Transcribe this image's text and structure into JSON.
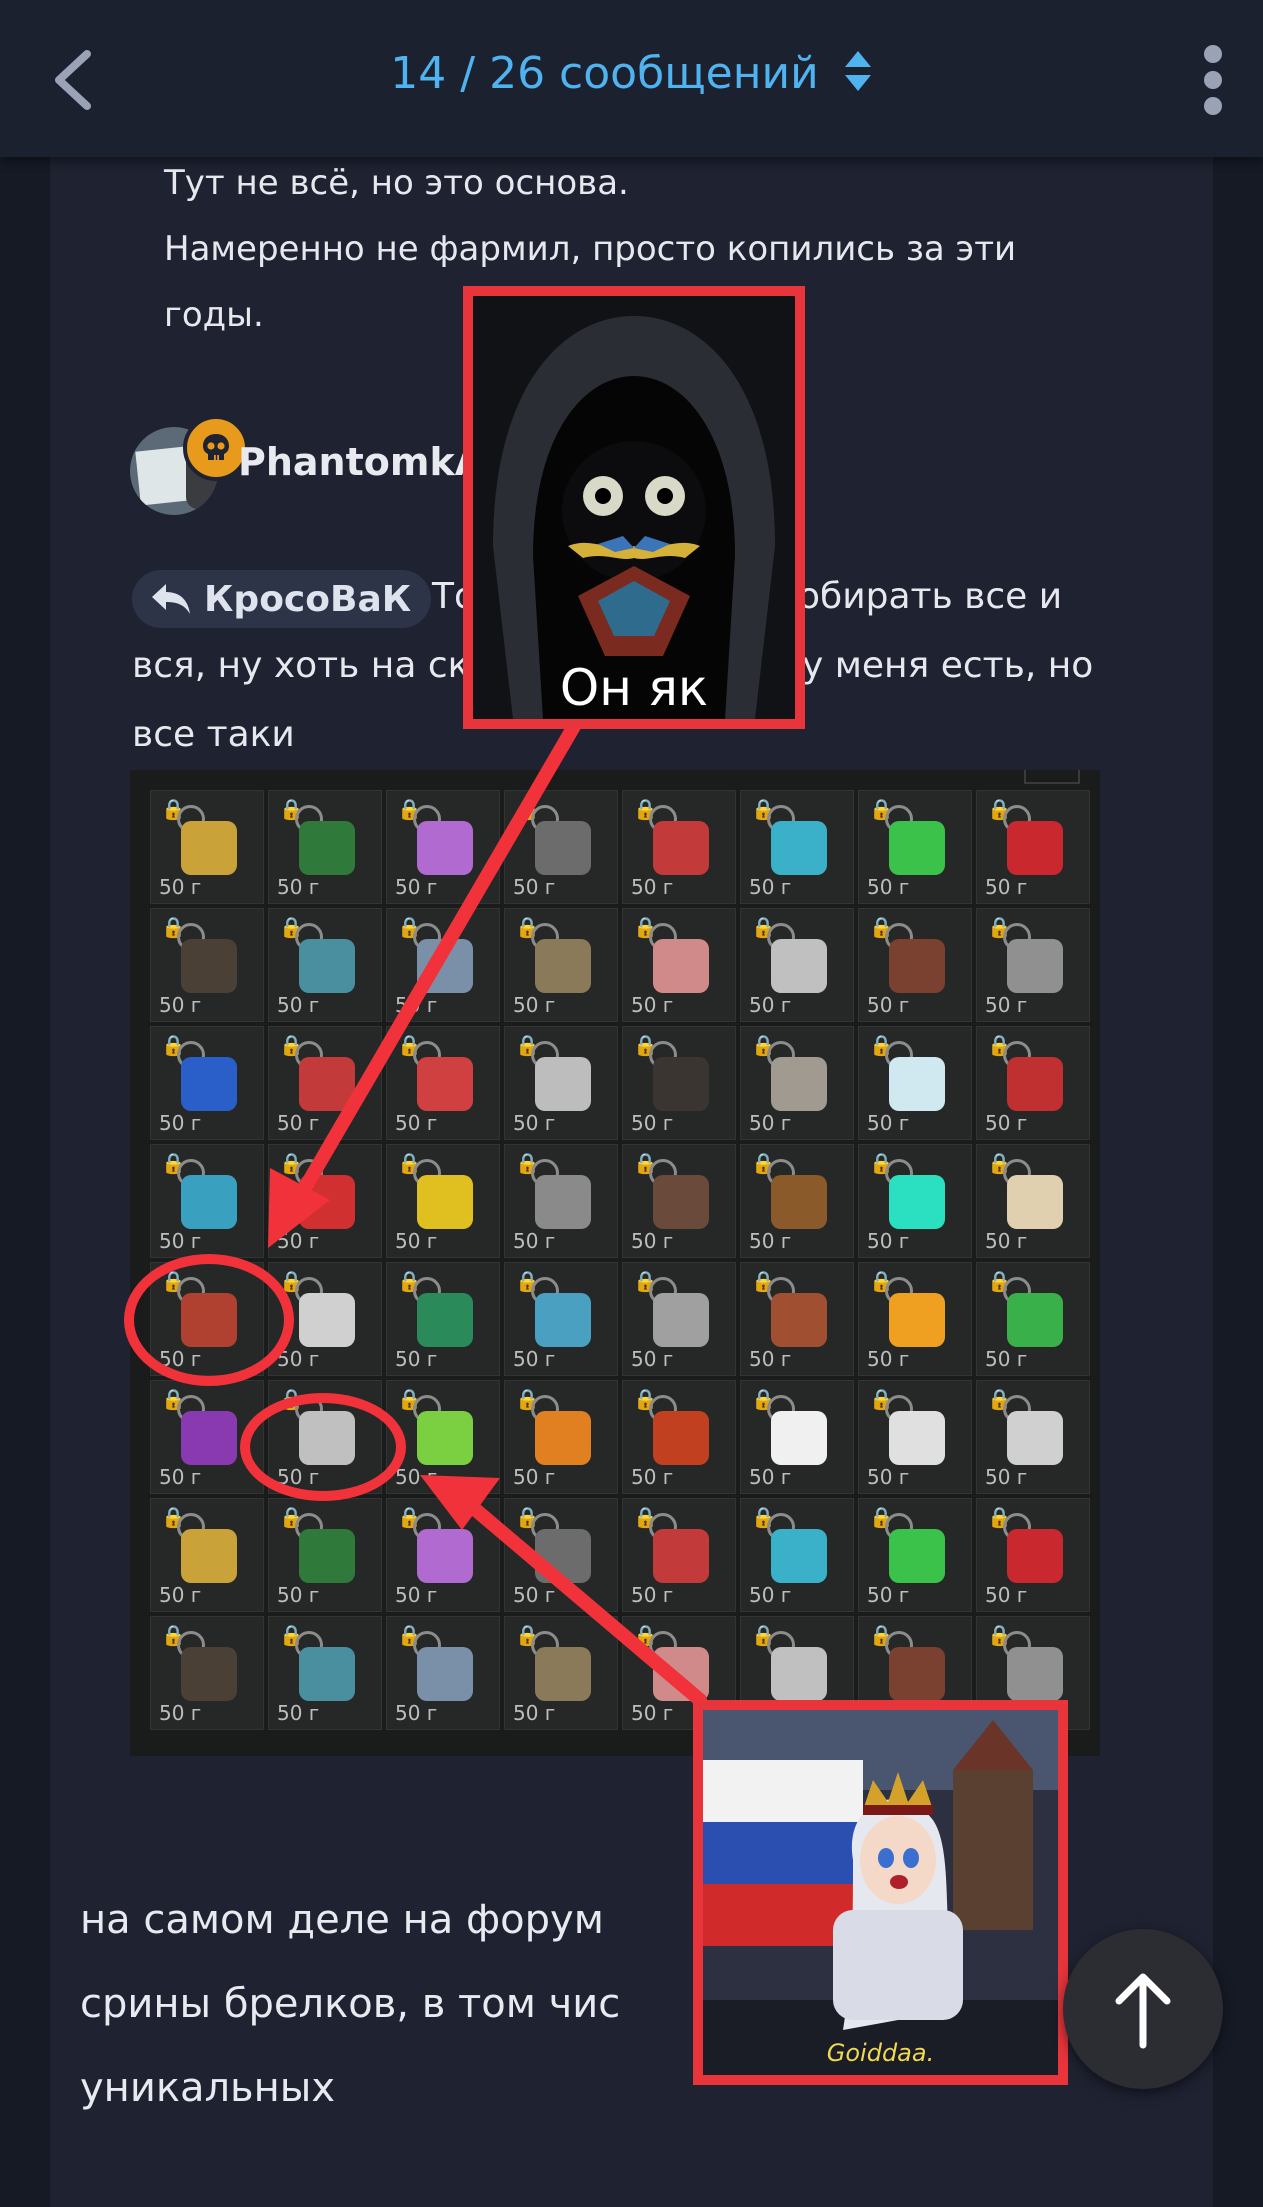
{
  "header": {
    "title": "14 / 26 сообщений",
    "accent_color": "#4fb3f0",
    "back_icon": "chevron-left-icon",
    "menu_icon": "vertical-dots-icon",
    "sort_icon": "up-down-arrows-icon"
  },
  "previous_post": {
    "lines": [
      "Тут не всё, но это основа.",
      "Намеренно не фармил, просто копились за эти",
      "годы."
    ]
  },
  "post": {
    "author": "PhantomkA",
    "author_badge_icon": "skull-icon",
    "badge_color": "#e89a1c",
    "quote_chip": {
      "icon": "reply-arrow-icon",
      "label": "КросоВаК"
    },
    "line1_start": "То",
    "line1_end": "обирать все и",
    "line2_start": "вся, ну хоть на ск",
    "line2_end": "у меня есть, но",
    "line3": "все таки",
    "inventory": {
      "price_label": "50 г",
      "rows": 8,
      "cols": 8
    }
  },
  "meme_top": {
    "caption": "Он як"
  },
  "meme_bottom": {
    "caption": "Goiddaa."
  },
  "next_post": {
    "line1": "на самом деле на форум",
    "line2": "срины брелков, в том чис",
    "line3": "уникальных"
  },
  "scroll_top_icon": "arrow-up-icon"
}
